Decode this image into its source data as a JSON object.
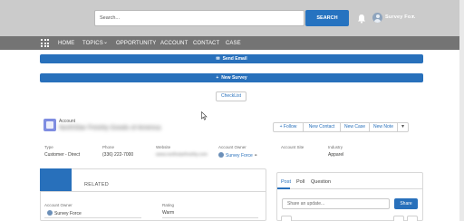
{
  "header": {
    "search_placeholder": "Search...",
    "search_button": "SEARCH",
    "user_name": "Survey Fo..."
  },
  "nav": {
    "items": [
      "HOME",
      "TOPICS",
      "OPPORTUNITY",
      "ACCOUNT",
      "CONTACT",
      "CASE"
    ],
    "topics_caret": "⌄"
  },
  "actions": {
    "send_email": "Send Email",
    "new_survey": "New Survey",
    "checklist": "CheckList"
  },
  "record": {
    "object_label": "Account",
    "name": "NorthStar Freshly Goods of America",
    "buttons": [
      "+ Follow",
      "New Contact",
      "New Case",
      "New Note"
    ],
    "more": "▾"
  },
  "highlights": {
    "type_label": "Type",
    "type_value": "Customer - Direct",
    "phone_label": "Phone",
    "phone_value": "(336) 222-7000",
    "website_label": "Website",
    "website_value": "www.northstarfreshly.com",
    "owner_label": "Account Owner",
    "owner_value": "Survey Force",
    "site_label": "Account Site",
    "industry_label": "Industry",
    "industry_value": "Apparel"
  },
  "details": {
    "tab_related": "RELATED",
    "owner_label": "Account Owner",
    "owner_value": "Survey Force",
    "rating_label": "Rating",
    "rating_value": "Warm"
  },
  "publisher": {
    "tabs": [
      "Post",
      "Poll",
      "Question"
    ],
    "placeholder": "Share an update...",
    "share_button": "Share"
  }
}
